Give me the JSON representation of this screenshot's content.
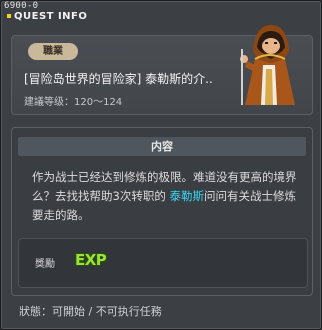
{
  "quest_id": "6900-0",
  "window_title": "QUEST INFO",
  "header": {
    "job_badge": "職業",
    "quest_title": "[冒险岛世界的冒险家] 泰勒斯的介..",
    "level_text": "建議等级：120～124"
  },
  "content": {
    "section_title": "内容",
    "desc_part1": "作为战士已经达到修炼的极限。难道没有更高的境界么？去找找帮助3次转职的 ",
    "npc_name": "泰勒斯",
    "desc_part2": "问问有关战士修炼要走的路。"
  },
  "reward": {
    "label": "獎勵",
    "exp_text": "EXP"
  },
  "status_text": "狀態：可開始 / 不可执行任務",
  "colors": {
    "npc_name": "#38d4f0",
    "exp": "#9ce23c",
    "badge": "#c9b99a"
  }
}
